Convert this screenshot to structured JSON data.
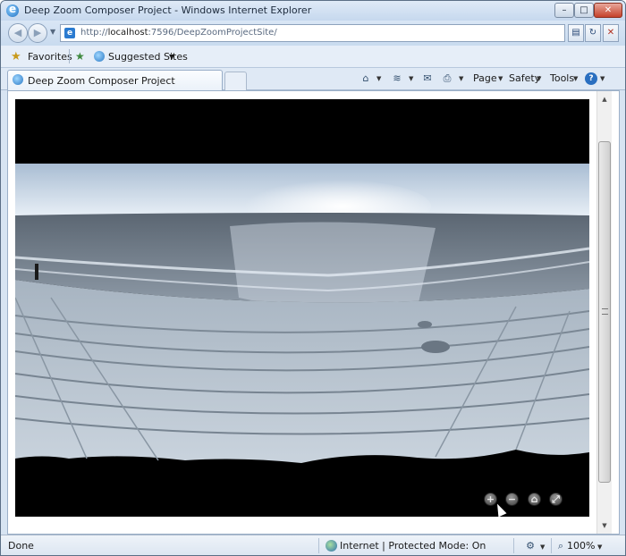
{
  "window": {
    "title": "Deep Zoom Composer Project - Windows Internet Explorer",
    "minimize_glyph": "–",
    "maximize_glyph": "□",
    "close_glyph": "✕"
  },
  "address_bar": {
    "url_prefix": "http://",
    "url_host": "localhost",
    "url_rest": ":7596/DeepZoomProjectSite/",
    "back_glyph": "◀",
    "forward_glyph": "▶"
  },
  "favorites_bar": {
    "favorites_label": "Favorites",
    "suggested_sites_label": "Suggested Sites"
  },
  "tab": {
    "label": "Deep Zoom Composer Project"
  },
  "command_bar": {
    "page_label": "Page",
    "safety_label": "Safety",
    "tools_label": "Tools",
    "icons": [
      "home-icon",
      "feeds-icon",
      "read-mail-icon",
      "print-icon",
      "help-icon"
    ]
  },
  "viewer": {
    "zoom_in_glyph": "+",
    "zoom_out_glyph": "−",
    "home_glyph": "⌂",
    "fullscreen_glyph": "⤢"
  },
  "status_bar": {
    "status_text": "Done",
    "zone_text": "Internet | Protected Mode: On",
    "zoom_level": "100%"
  },
  "colors": {
    "title_bar": "#c6d8ee",
    "viewer_background": "#000000",
    "close_button": "#c5412a"
  }
}
